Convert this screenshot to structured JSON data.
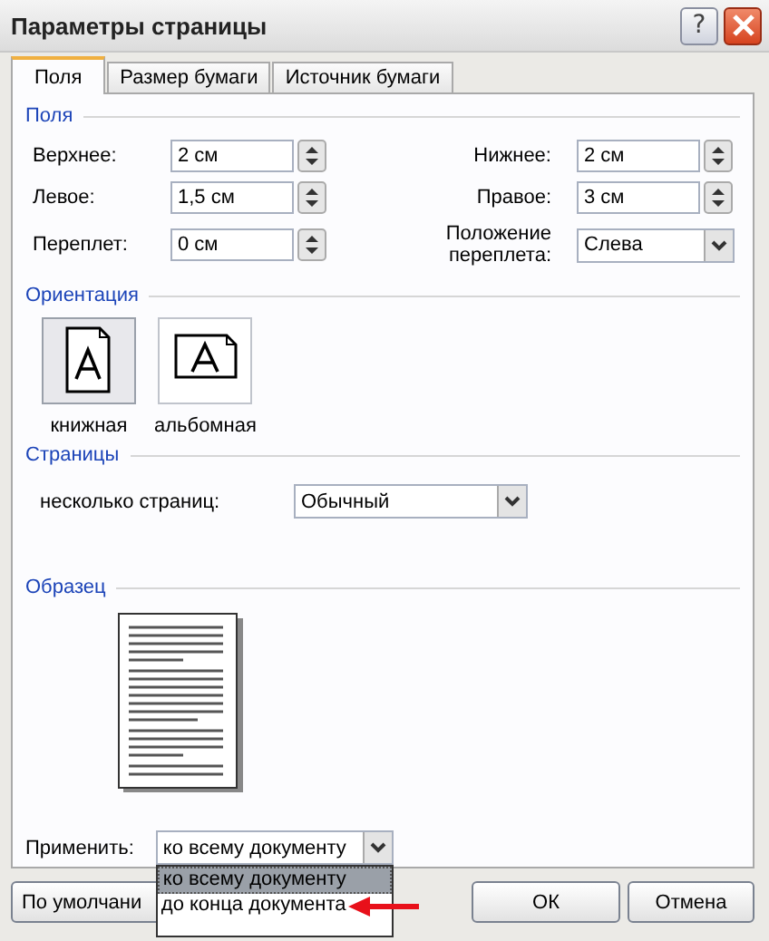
{
  "window": {
    "title": "Параметры страницы",
    "help": "?"
  },
  "tabs": [
    {
      "label": "Поля",
      "selected": true
    },
    {
      "label": "Размер бумаги",
      "selected": false
    },
    {
      "label": "Источник бумаги",
      "selected": false
    }
  ],
  "margins": {
    "heading": "Поля",
    "fields": [
      {
        "label": "Верхнее:",
        "value": "2 см",
        "kind": "spin"
      },
      {
        "label": "Нижнее:",
        "value": "2 см",
        "kind": "spin"
      },
      {
        "label": "Левое:",
        "value": "1,5 см",
        "kind": "spin"
      },
      {
        "label": "Правое:",
        "value": "3 см",
        "kind": "spin"
      },
      {
        "label": "Переплет:",
        "value": "0 см",
        "kind": "spin"
      },
      {
        "label": "Положение переплета:",
        "value": "Слева",
        "kind": "combo"
      }
    ]
  },
  "orientation": {
    "heading": "Ориентация",
    "options": [
      {
        "label": "книжная",
        "kind": "portrait",
        "selected": true
      },
      {
        "label": "альбомная",
        "kind": "landscape",
        "selected": false
      }
    ]
  },
  "pages": {
    "heading": "Страницы",
    "label": "несколько страниц:",
    "value": "Обычный"
  },
  "sample": {
    "heading": "Образец"
  },
  "apply": {
    "label": "Применить:",
    "value": "ко всему документу",
    "expanded": true,
    "options": [
      {
        "label": "ко всему документу",
        "selected": true
      },
      {
        "label": "до конца документа",
        "selected": false
      }
    ]
  },
  "buttons": [
    {
      "label": "По умолчани",
      "kind": "default"
    },
    {
      "label": "ОК",
      "kind": "ok"
    },
    {
      "label": "Отмена",
      "kind": "cancel"
    }
  ]
}
